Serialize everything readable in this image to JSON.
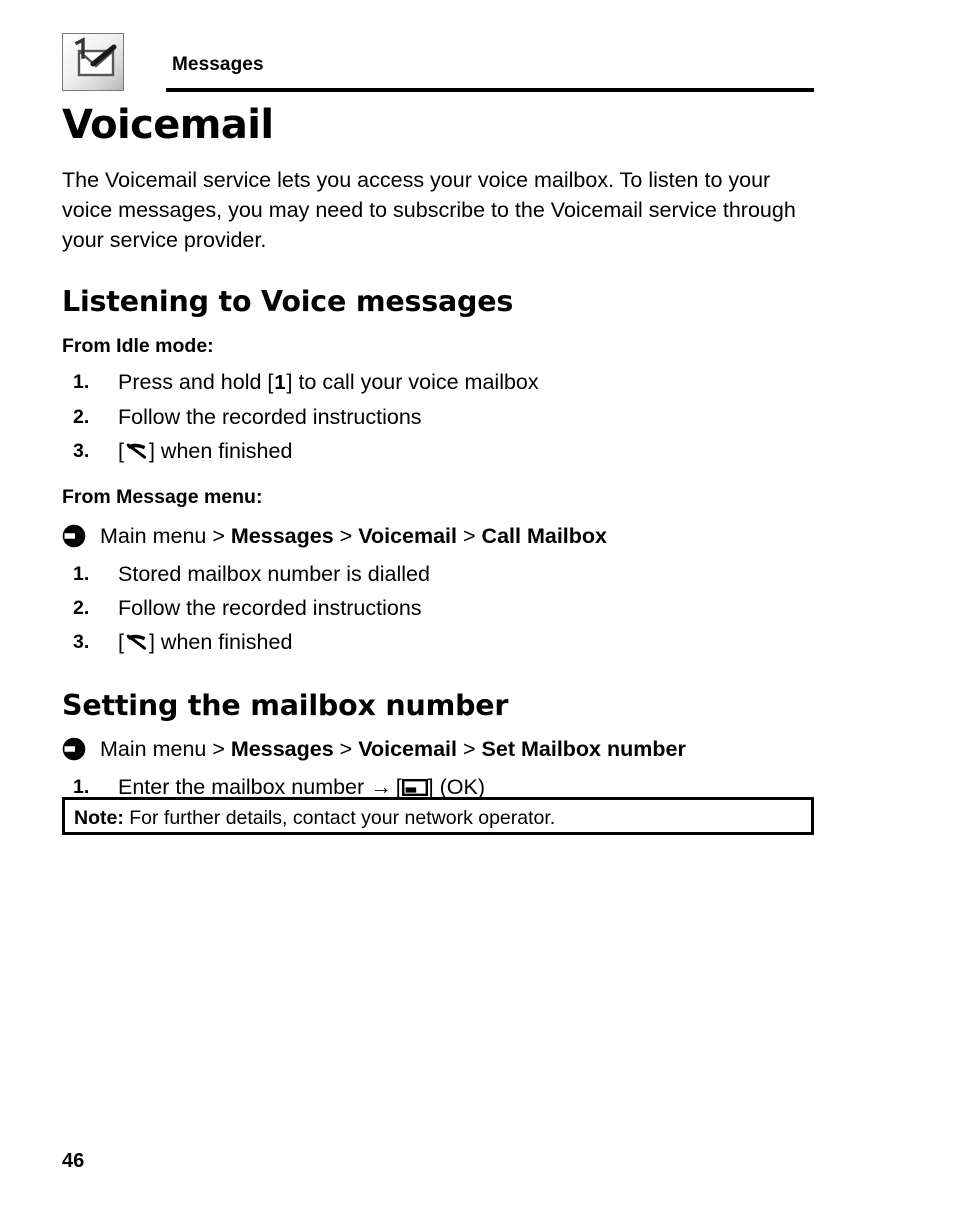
{
  "header": {
    "chapter_title": "Messages",
    "icon": "envelope-with-one-icon"
  },
  "document": {
    "title": "Voicemail",
    "intro": "The Voicemail service lets you access your voice mailbox. To listen to your voice messages, you may need to subscribe to the Voicemail service through your service provider.",
    "page_number": "46"
  },
  "sections": [
    {
      "heading": "Listening to Voice messages",
      "subheading_idle": "From Idle mode:",
      "idle_steps": [
        {
          "num": "1.",
          "pre": "Press and hold [",
          "key": "1",
          "post": "] to call your voice mailbox"
        },
        {
          "num": "2.",
          "pre": "Follow the recorded instructions",
          "key": "",
          "post": ""
        },
        {
          "num": "3.",
          "pre": "[",
          "key": "end-call-icon",
          "post": "] when finished"
        }
      ],
      "subheading_menu": "From Message menu:",
      "breadcrumb": {
        "icon": "circle-arrow-right-icon",
        "root": "Main menu",
        "sep": ">",
        "items": [
          "Messages",
          "Voicemail",
          "Call Mailbox"
        ]
      },
      "menu_steps": [
        {
          "num": "1.",
          "pre": "Stored mailbox number is dialled",
          "key": "",
          "post": ""
        },
        {
          "num": "2.",
          "pre": "Follow the recorded instructions",
          "key": "",
          "post": ""
        },
        {
          "num": "3.",
          "pre": "[",
          "key": "end-call-icon",
          "post": "] when finished"
        }
      ]
    },
    {
      "heading": "Setting the mailbox number",
      "breadcrumb": {
        "icon": "circle-arrow-right-icon",
        "root": "Main menu",
        "sep": ">",
        "items": [
          "Messages",
          "Voicemail",
          "Set Mailbox number"
        ]
      },
      "steps": [
        {
          "num": "1.",
          "pre": "Enter the mailbox number",
          "arrow": "→",
          "bracket_open": "[",
          "key": "left-softkey-icon",
          "bracket_close": "]",
          "post": "(OK)"
        }
      ]
    }
  ],
  "note": {
    "label": "Note:",
    "text": "For further details, contact your network operator."
  },
  "colors": {
    "text": "#000000",
    "rule": "#000000",
    "page_background": "#ffffff"
  }
}
